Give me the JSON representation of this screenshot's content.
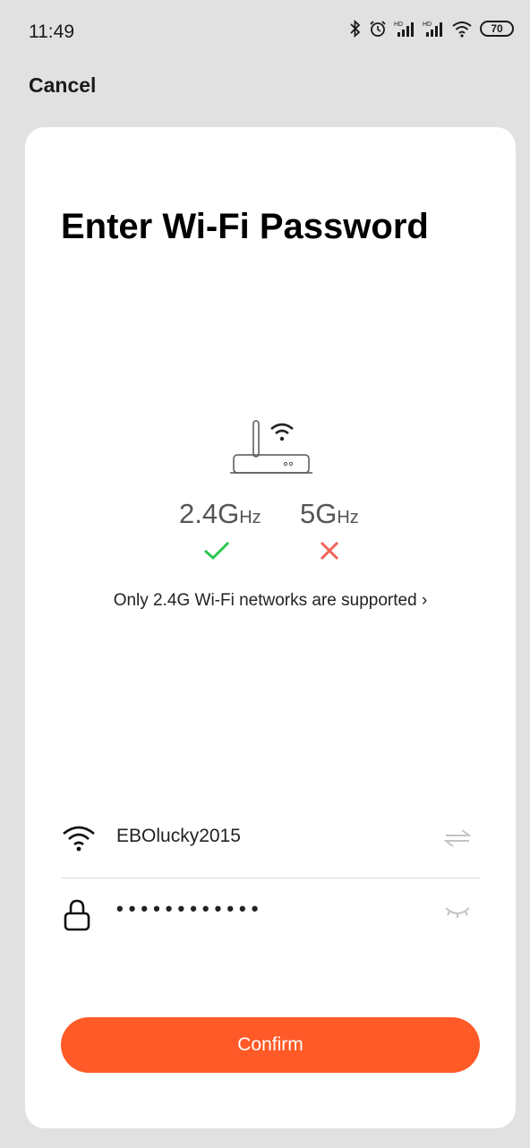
{
  "status_bar": {
    "time": "11:49",
    "battery": "70",
    "icons": [
      "bluetooth-icon",
      "alarm-icon",
      "signal-hd-icon",
      "signal-hd-icon",
      "wifi-icon",
      "battery-icon"
    ]
  },
  "header": {
    "cancel_label": "Cancel"
  },
  "card": {
    "title": "Enter Wi-Fi Password",
    "illustration": "router-icon",
    "bands": [
      {
        "label": "2.4G",
        "unit": "Hz",
        "supported": true,
        "mark_icon": "check-icon",
        "color": "#2bc654"
      },
      {
        "label": "5G",
        "unit": "Hz",
        "supported": false,
        "mark_icon": "cross-icon",
        "color": "#f0625a"
      }
    ],
    "support_note": "Only 2.4G Wi-Fi networks are supported",
    "support_arrow": "›"
  },
  "form": {
    "ssid": {
      "icon": "wifi-icon",
      "value": "EBOlucky2015",
      "action_icon": "switch-network-icon"
    },
    "password": {
      "icon": "lock-icon",
      "value": "••••••••••••",
      "action_icon": "eye-closed-icon"
    }
  },
  "confirm": {
    "label": "Confirm",
    "color": "#ff5a27"
  }
}
